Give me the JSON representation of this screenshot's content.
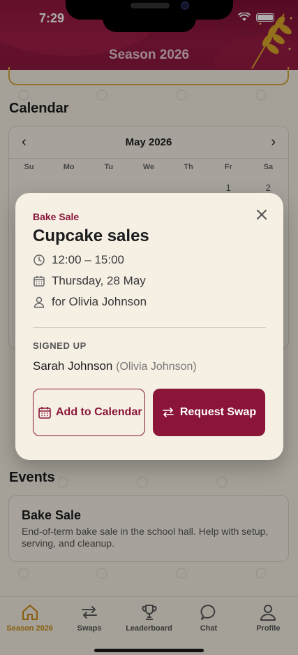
{
  "status_bar": {
    "time": "7:29"
  },
  "header": {
    "title": "Season 2026"
  },
  "calendar": {
    "section_title": "Calendar",
    "month": "May 2026",
    "weekdays": [
      "Su",
      "Mo",
      "Tu",
      "We",
      "Th",
      "Fr",
      "Sa"
    ],
    "first_row": [
      "",
      "",
      "",
      "",
      "",
      "1",
      "2"
    ]
  },
  "events": {
    "section_title": "Events",
    "card": {
      "title": "Bake Sale",
      "description": "End-of-term bake sale in the school hall. Help with setup, serving, and cleanup."
    }
  },
  "modal": {
    "category": "Bake Sale",
    "title": "Cupcake sales",
    "time": "12:00 – 15:00",
    "date": "Thursday, 28 May",
    "for_person": "for Olivia Johnson",
    "signed_up_label": "SIGNED UP",
    "signed_up_name": "Sarah Johnson",
    "signed_up_for": "(Olivia Johnson)",
    "add_calendar_label": "Add to Calendar",
    "request_swap_label": "Request Swap"
  },
  "tabbar": {
    "items": [
      {
        "label": "Season 2026",
        "icon": "home-icon",
        "active": true
      },
      {
        "label": "Swaps",
        "icon": "swap-icon",
        "active": false
      },
      {
        "label": "Leaderboard",
        "icon": "trophy-icon",
        "active": false
      },
      {
        "label": "Chat",
        "icon": "chat-icon",
        "active": false
      },
      {
        "label": "Profile",
        "icon": "person-icon",
        "active": false
      }
    ]
  },
  "colors": {
    "brand": "#8a1538",
    "accent": "#c98b12",
    "background": "#f3ede0"
  }
}
